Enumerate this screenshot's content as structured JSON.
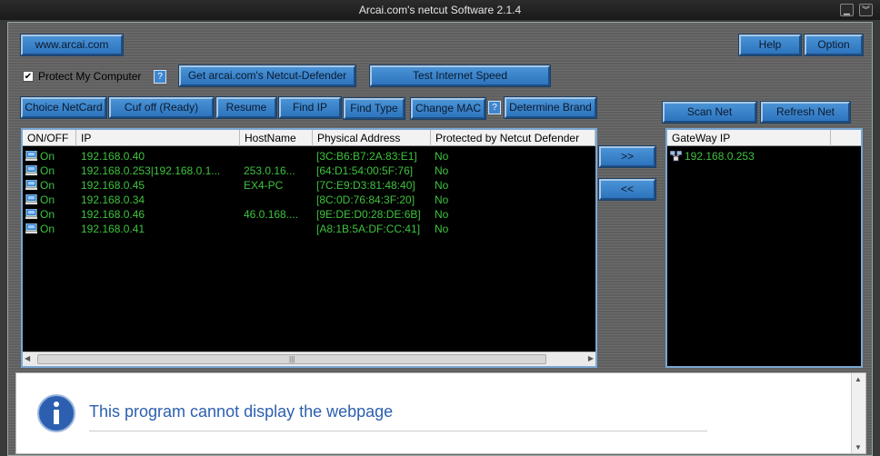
{
  "window": {
    "title": "Arcai.com's netcut Software 2.1.4"
  },
  "toolbar": {
    "site_link": "www.arcai.com",
    "help": "Help",
    "option": "Option",
    "protect_label": "Protect My Computer",
    "protect_checked": true,
    "question": "?",
    "get_defender": "Get arcai.com's Netcut-Defender",
    "test_speed": "Test Internet Speed"
  },
  "actions": {
    "choice_netcard": "Choice NetCard",
    "cut_off": "Cuf off (Ready)",
    "resume": "Resume",
    "find_ip": "Find IP",
    "find_type": "Find Type",
    "change_mac": "Change MAC",
    "determine_brand": "Determine Brand",
    "scan_net": "Scan Net",
    "refresh_net": "Refresh Net",
    "move_right": ">>",
    "move_left": "<<"
  },
  "host_table": {
    "columns": [
      "ON/OFF",
      "IP",
      "HostName",
      "Physical Address",
      "Protected by Netcut Defender"
    ],
    "rows": [
      {
        "status": "On",
        "ip": "192.168.0.40",
        "hostname": "",
        "mac": "[3C:B6:B7:2A:83:E1]",
        "protected": "No"
      },
      {
        "status": "On",
        "ip": "192.168.0.253|192.168.0.1...",
        "hostname": "253.0.16...",
        "mac": "[64:D1:54:00:5F:76]",
        "protected": "No"
      },
      {
        "status": "On",
        "ip": "192.168.0.45",
        "hostname": "EX4-PC",
        "mac": "[7C:E9:D3:81:48:40]",
        "protected": "No"
      },
      {
        "status": "On",
        "ip": "192.168.0.34",
        "hostname": "",
        "mac": "[8C:0D:76:84:3F:20]",
        "protected": "No"
      },
      {
        "status": "On",
        "ip": "192.168.0.46",
        "hostname": "46.0.168....",
        "mac": "[9E:DE:D0:28:DE:6B]",
        "protected": "No"
      },
      {
        "status": "On",
        "ip": "192.168.0.41",
        "hostname": "",
        "mac": "[A8:1B:5A:DF:CC:41]",
        "protected": "No"
      }
    ]
  },
  "gateway_table": {
    "column": "GateWay IP",
    "rows": [
      {
        "ip": "192.168.0.253"
      }
    ]
  },
  "browser_panel": {
    "message": "This program cannot display the webpage"
  },
  "colors": {
    "button": "#3a82cc",
    "list_text": "#3ec23e",
    "list_bg": "#000000",
    "info_icon": "#2c5fb0"
  }
}
